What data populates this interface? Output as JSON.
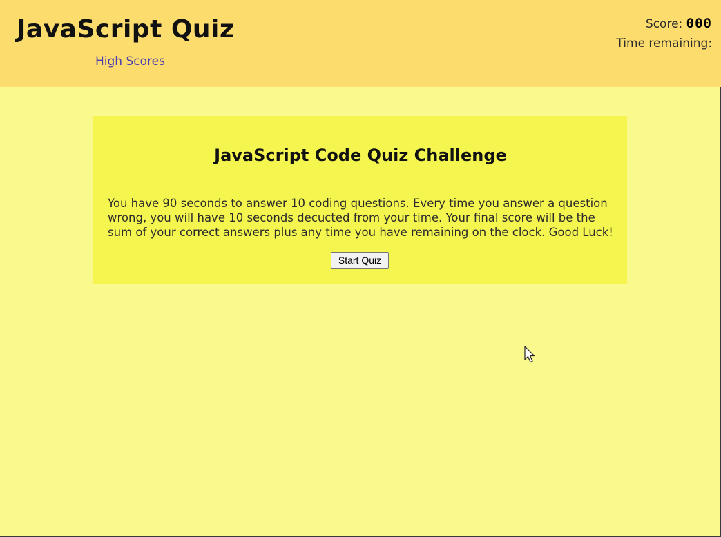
{
  "header": {
    "title": "JavaScript Quiz",
    "high_scores_link": "High Scores",
    "score_label": "Score:",
    "score_value": "000",
    "time_label": "Time remaining:"
  },
  "quiz_card": {
    "title": "JavaScript Code Quiz Challenge",
    "instructions": "You have 90 seconds to answer 10 coding questions. Every time you answer a question wrong, you will have 10 seconds decucted from your time. Your final score will be the sum of your correct answers plus any time you have remaining on the clock. Good Luck!",
    "start_button": "Start Quiz"
  },
  "cursor": {
    "icon": "mouse-pointer-icon"
  },
  "colors": {
    "header_background": "#fcdc6c",
    "page_background": "#f9f98d",
    "card_background": "#f5f550",
    "link": "#4b3cb0"
  }
}
